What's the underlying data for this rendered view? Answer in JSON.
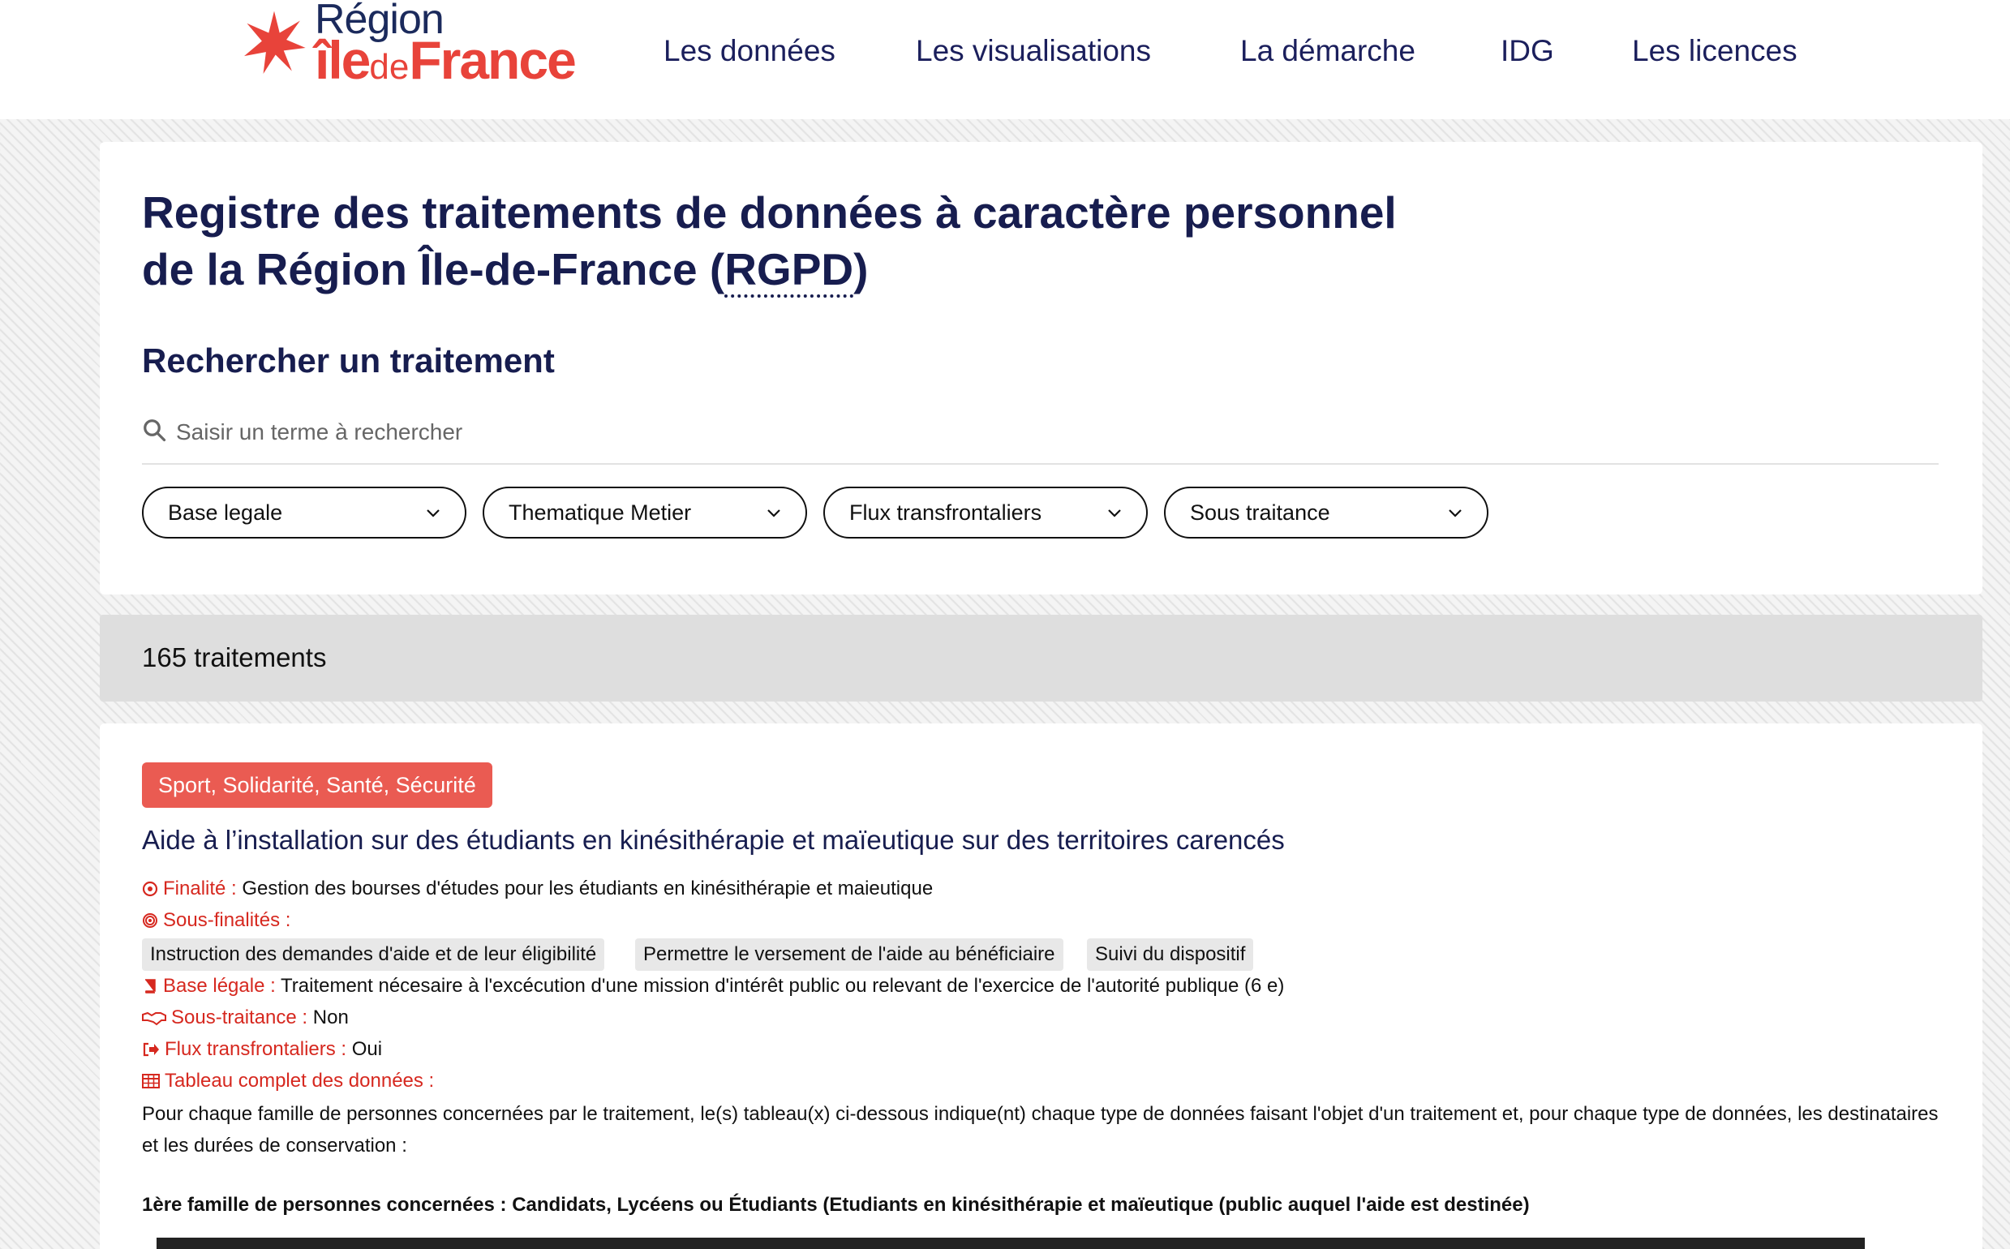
{
  "header": {
    "logo_line1": "Région",
    "logo_ile": "île",
    "logo_de": "de",
    "logo_france": "France",
    "nav": [
      "Les données",
      "Les visualisations",
      "La démarche",
      "IDG",
      "Les licences"
    ]
  },
  "search_card": {
    "title_line1": "Registre des traitements de données à caractère personnel",
    "title_line2_prefix": "de la Région Île-de-France (",
    "title_abbr": "RGPD",
    "title_line2_suffix": ")",
    "subtitle": "Rechercher un traitement",
    "search_placeholder": "Saisir un terme à rechercher",
    "filters": [
      "Base legale",
      "Thematique Metier",
      "Flux transfrontaliers",
      "Sous traitance"
    ]
  },
  "count": "165 traitements",
  "result": {
    "tag": "Sport, Solidarité, Santé, Sécurité",
    "title": "Aide à l’installation sur des étudiants en kinésithérapie et maïeutique sur des territoires carencés",
    "finalite_label": "Finalité :",
    "finalite_value": "Gestion des bourses d'études pour les étudiants en kinésithérapie et maieutique",
    "sous_finalites_label": "Sous-finalités :",
    "sous_finalites": [
      "Instruction des demandes d'aide et de leur éligibilité",
      "Permettre le versement de l'aide au bénéficiaire",
      "Suivi du dispositif"
    ],
    "base_legale_label": "Base légale :",
    "base_legale_value": "Traitement nécesaire à l'excécution d'une mission d'intérêt public ou relevant de l'exercice de l'autorité publique (6 e)",
    "sous_traitance_label": "Sous-traitance :",
    "sous_traitance_value": "Non",
    "flux_label": "Flux transfrontaliers :",
    "flux_value": "Oui",
    "tableau_label": "Tableau complet des données :",
    "description": "Pour chaque famille de personnes concernées par le traitement, le(s) tableau(x) ci-dessous indique(nt) chaque type de données faisant l'objet d'un traitement et, pour chaque type de données, les destinataires et les durées de conservation :",
    "family": "1ère famille de personnes concernées : Candidats, Lycéens ou Étudiants (Etudiants en kinésithérapie et maïeutique (public auquel l'aide est destinée)"
  },
  "icons": [
    "region-star-logo-icon",
    "search-icon",
    "chevron-down-icon",
    "target-icon",
    "bullseye-icon",
    "book-icon",
    "handshake-icon",
    "sign-out-icon",
    "table-icon"
  ],
  "colors": {
    "brand_red": "#e8433a",
    "navy": "#171d4f",
    "tag_bg": "#ea5b52",
    "label_red": "#d6281f"
  }
}
